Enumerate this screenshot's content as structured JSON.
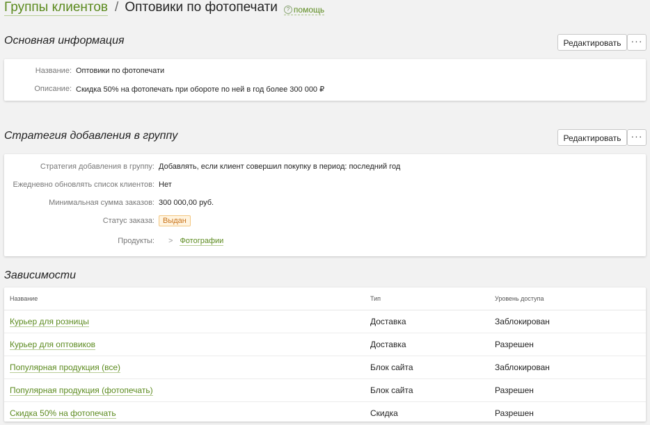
{
  "header": {
    "breadcrumb_link": "Группы клиентов",
    "separator": "/",
    "title": "Оптовики по фотопечати",
    "help_icon": "question-circle-icon",
    "help_label": "помощь"
  },
  "basic_info": {
    "title": "Основная информация",
    "edit_label": "Редактировать",
    "more_label": "···",
    "fields": [
      {
        "label": "Название:",
        "value": "Оптовики по фотопечати"
      },
      {
        "label": "Описание:",
        "value": "Скидка 50% на фотопечать при обороте по ней в год более 300 000 ₽"
      }
    ]
  },
  "strategy": {
    "title": "Стратегия добавления в группу",
    "edit_label": "Редактировать",
    "more_label": "···",
    "fields": [
      {
        "label": "Стратегия добавления в группу:",
        "value": "Добавлять, если клиент совершил покупку в период: последний год"
      },
      {
        "label": "Ежедневно обновлять список клиентов:",
        "value": "Нет"
      },
      {
        "label": "Минимальная сумма заказов:",
        "value": "300 000,00 руб."
      },
      {
        "label": "Статус заказа:",
        "value": "Выдан"
      },
      {
        "label": "Продукты:",
        "value": "Фотографии"
      }
    ],
    "status_badge_color": "#c9731a",
    "chevron_icon": "chevron-right-icon"
  },
  "dependencies": {
    "title": "Зависимости",
    "columns": [
      "Название",
      "Тип",
      "Уровень доступа"
    ],
    "rows": [
      {
        "name": "Курьер для розницы",
        "type": "Доставка",
        "access": "Заблокирован"
      },
      {
        "name": "Курьер для оптовиков",
        "type": "Доставка",
        "access": "Разрешен"
      },
      {
        "name": "Популярная продукция (все)",
        "type": "Блок сайта",
        "access": "Заблокирован"
      },
      {
        "name": "Популярная продукция (фотопечать)",
        "type": "Блок сайта",
        "access": "Разрешен"
      },
      {
        "name": "Скидка 50% на фотопечать",
        "type": "Скидка",
        "access": "Разрешен"
      }
    ]
  },
  "colors": {
    "accent_link": "#5b8a1e",
    "background": "#f2f2f2"
  }
}
